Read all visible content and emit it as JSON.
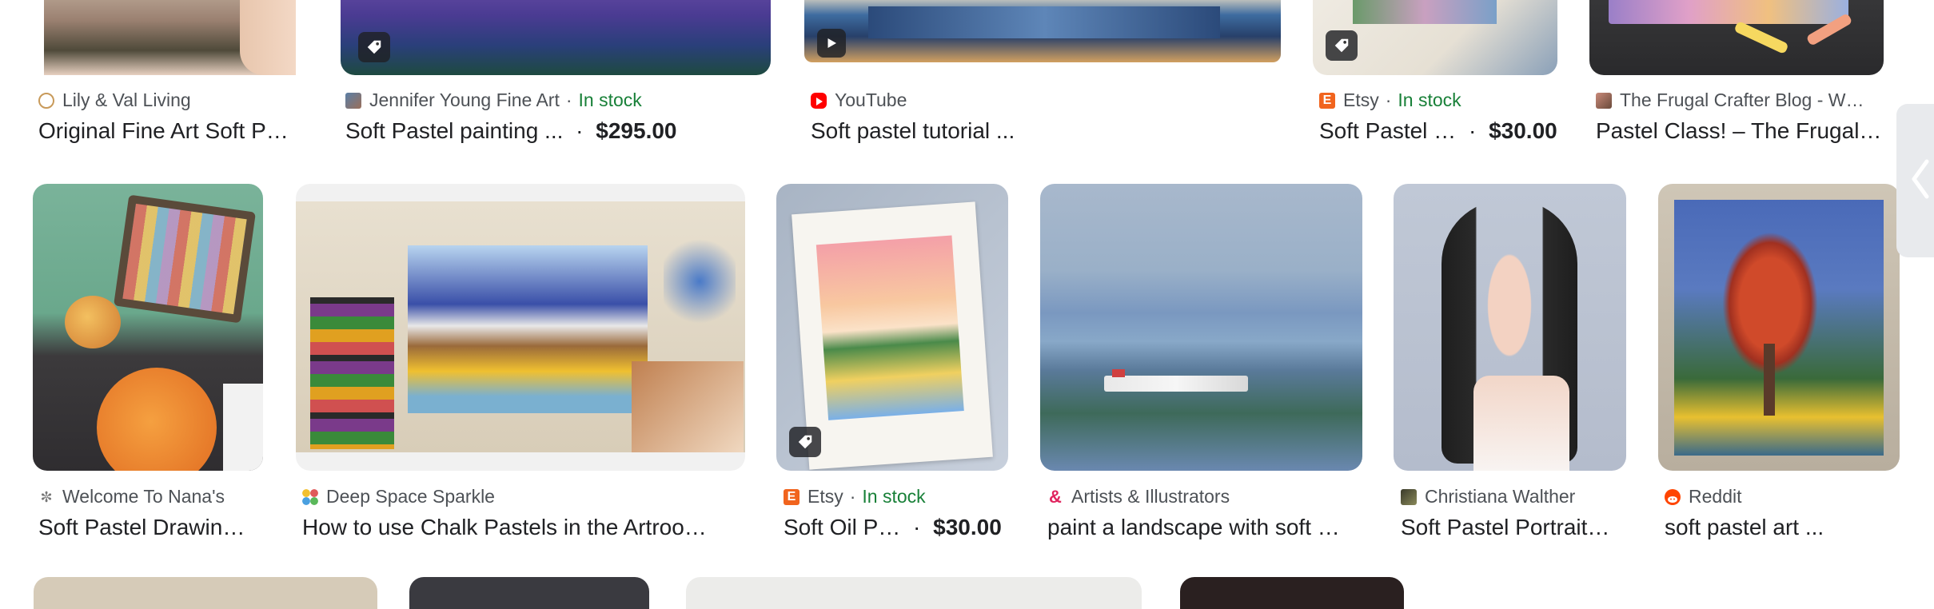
{
  "row1": [
    {
      "source": "Lily & Val Living",
      "stock": "",
      "title": "Original Fine Art Soft P…",
      "price": ""
    },
    {
      "source": "Jennifer Young Fine Art",
      "stock": "In stock",
      "title": "Soft Pastel painting ...",
      "price": "$295.00"
    },
    {
      "source": "YouTube",
      "stock": "",
      "title": "Soft pastel tutorial ...",
      "price": ""
    },
    {
      "source": "Etsy",
      "stock": "In stock",
      "title": "Soft Pastel …",
      "price": "$30.00"
    },
    {
      "source": "The Frugal Crafter Blog - W…",
      "stock": "",
      "title": "Pastel Class! – The Frugal…",
      "price": ""
    }
  ],
  "row2": [
    {
      "source": "Welcome To Nana's",
      "stock": "",
      "title": "Soft Pastel Drawin…",
      "price": ""
    },
    {
      "source": "Deep Space Sparkle",
      "stock": "",
      "title": "How to use Chalk Pastels in the Artroo…",
      "price": ""
    },
    {
      "source": "Etsy",
      "stock": "In stock",
      "title": "Soft Oil P…",
      "price": "$30.00"
    },
    {
      "source": "Artists & Illustrators",
      "stock": "",
      "title": "paint a landscape with soft …",
      "price": ""
    },
    {
      "source": "Christiana Walther",
      "stock": "",
      "title": "Soft Pastel Portrait…",
      "price": ""
    },
    {
      "source": "Reddit",
      "stock": "",
      "title": "soft pastel art ...",
      "price": ""
    }
  ],
  "separator": "·",
  "colors": {
    "stock": "#188038",
    "youtube": "#ff0000",
    "etsy": "#f1641e",
    "reddit": "#ff4500"
  },
  "icons": {
    "shopping": "tag-icon",
    "video": "play-icon",
    "side": "chevron-left-icon"
  }
}
